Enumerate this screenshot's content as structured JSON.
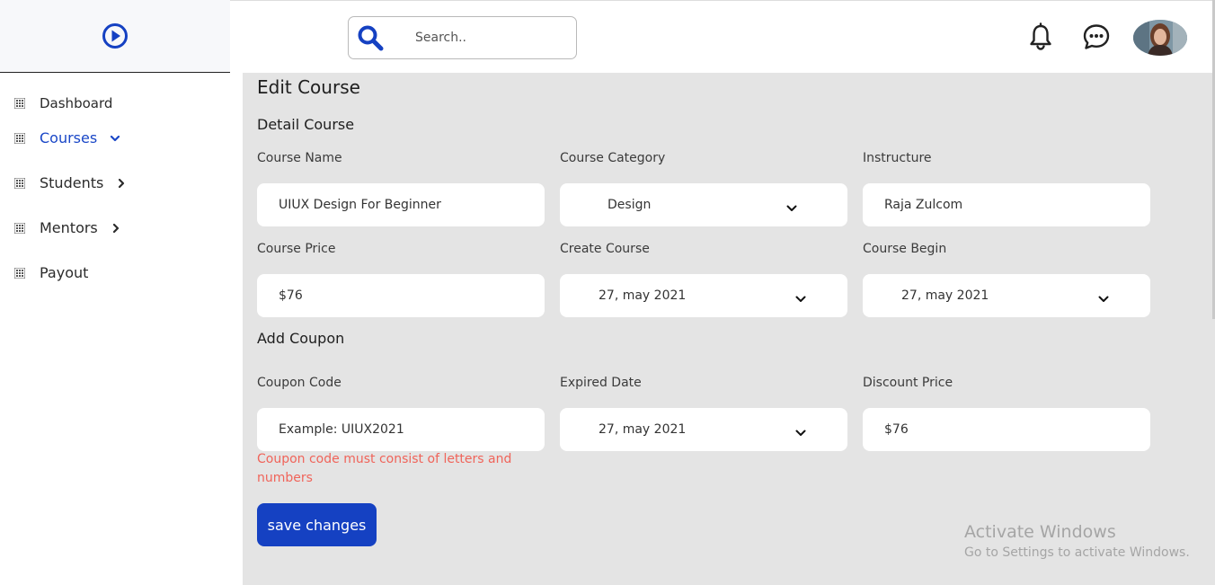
{
  "colors": {
    "accent": "#1541c2",
    "active_nav": "#1a47c7",
    "error": "#f0645a",
    "content_bg": "#e4e4e4"
  },
  "header": {
    "search": {
      "placeholder": "Search.."
    }
  },
  "sidebar": {
    "items": [
      {
        "label": "Dashboard",
        "icon": "grid-icon"
      },
      {
        "label": "Courses",
        "icon": "grid-icon",
        "chevron": "chevron-down-icon",
        "active": true
      },
      {
        "label": "Students",
        "icon": "grid-icon",
        "chevron": "chevron-right-icon"
      },
      {
        "label": "Mentors",
        "icon": "grid-icon",
        "chevron": "chevron-right-icon"
      },
      {
        "label": "Payout",
        "icon": "grid-icon"
      }
    ]
  },
  "main": {
    "title": "Edit Course",
    "detail": {
      "heading": "Detail Course",
      "course_name": {
        "label": "Course Name",
        "value": "UIUX Design For Beginner"
      },
      "course_category": {
        "label": "Course Category",
        "value": "Design"
      },
      "instructure": {
        "label": "Instructure",
        "value": "Raja Zulcom"
      },
      "course_price": {
        "label": "Course Price",
        "value": "$76"
      },
      "create_course": {
        "label": "Create Course",
        "value": "27, may 2021"
      },
      "course_begin": {
        "label": "Course Begin",
        "value": "27, may 2021"
      }
    },
    "coupon": {
      "heading": "Add Coupon",
      "coupon_code": {
        "label": "Coupon Code",
        "value": "Example: UIUX2021"
      },
      "expired_date": {
        "label": "Expired Date",
        "value": "27, may 2021"
      },
      "discount_price": {
        "label": "Discount Price",
        "value": "$76"
      },
      "error": "Coupon code must consist of letters and numbers"
    },
    "save_label": "save changes"
  },
  "watermark": {
    "line1": "Activate Windows",
    "line2": "Go to Settings to activate Windows."
  }
}
